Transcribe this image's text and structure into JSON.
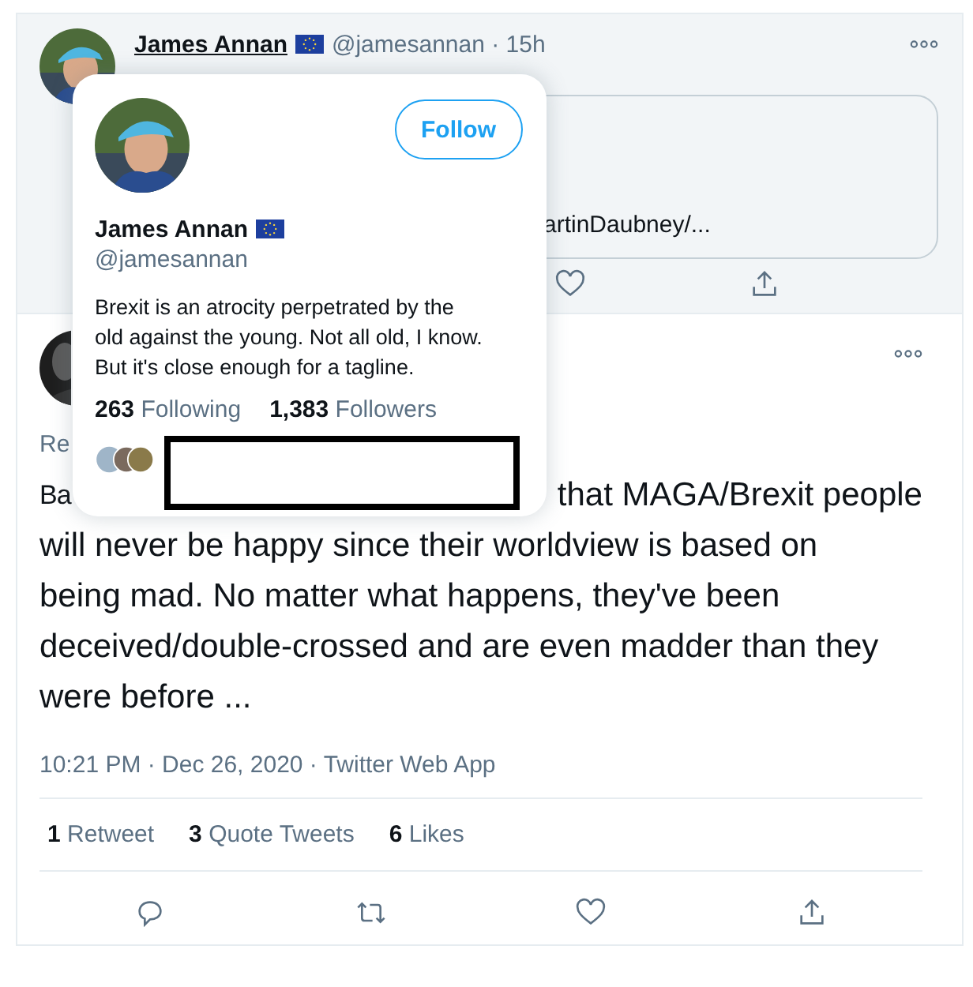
{
  "preview_tweet": {
    "hovered": true,
    "name": "James Annan",
    "handle": "@jamesannan",
    "time": "· 15h",
    "link_text": "artinDaubney/..."
  },
  "main_tweet": {
    "replying": "Re",
    "body_start": "Ba",
    "body_after": "that MAGA/Brexit people",
    "body_rest": "will never be happy since their worldview is based on being mad.  No matter what happens, they've been deceived/double-crossed and are even madder than they were before ...",
    "meta": "10:21 PM · Dec 26, 2020 · Twitter Web App",
    "stats": [
      {
        "count": "1",
        "label": "Retweet"
      },
      {
        "count": "3",
        "label": "Quote Tweets"
      },
      {
        "count": "6",
        "label": "Likes"
      }
    ]
  },
  "hover_card": {
    "name": "James Annan",
    "handle": "@jamesannan",
    "button": "Follow",
    "bio": "Brexit is an atrocity perpetrated by the old against the young. Not all old, I know. But it's close enough for a tagline.",
    "stats": [
      {
        "count": "263",
        "label": "Following"
      },
      {
        "count": "1,383",
        "label": "Followers"
      }
    ]
  }
}
